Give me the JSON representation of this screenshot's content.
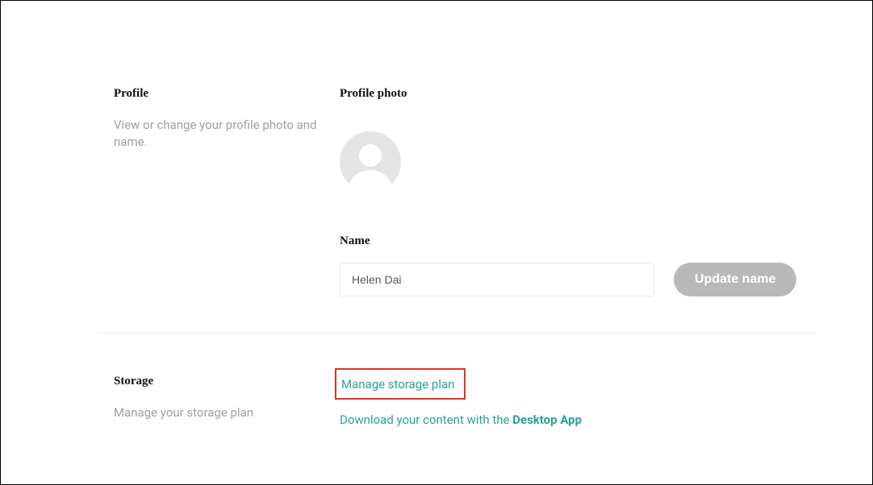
{
  "profile": {
    "section_title": "Profile",
    "section_description": "View or change your profile photo and name.",
    "photo_label": "Profile photo",
    "name_label": "Name",
    "name_value": "Helen Dai",
    "update_button": "Update name"
  },
  "storage": {
    "section_title": "Storage",
    "section_description": "Manage your storage plan",
    "manage_link": "Manage storage plan",
    "download_prefix": "Download your content with the ",
    "desktop_app_label": "Desktop App"
  }
}
